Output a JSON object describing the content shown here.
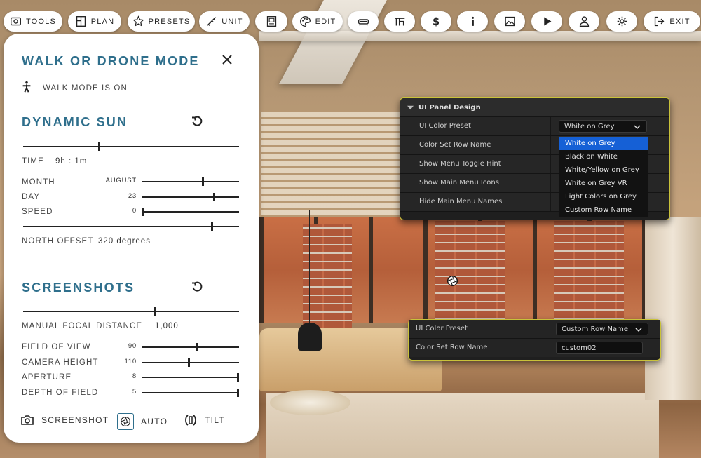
{
  "toolbar": {
    "tools": "TOOLS",
    "plan": "PLAN",
    "presets": "PRESETS",
    "unit": "UNIT",
    "edit": "EDIT",
    "exit": "EXIT"
  },
  "panel": {
    "walk": {
      "title": "WALK OR DRONE MODE",
      "status": "WALK MODE IS ON"
    },
    "sun": {
      "title": "DYNAMIC SUN",
      "time_label": "TIME",
      "time_value": "9h : 1m",
      "time_level": 0.35,
      "month_label": "MONTH",
      "month_value": "AUGUST",
      "month_level": 0.63,
      "day_label": "DAY",
      "day_value": "23",
      "day_level": 0.75,
      "speed_label": "SPEED",
      "speed_value": "0",
      "speed_level": 0.0,
      "north_level": 0.88,
      "north_label": "NORTH OFFSET",
      "north_value": "320 degrees"
    },
    "shots": {
      "title": "SCREENSHOTS",
      "focal_level": 0.61,
      "focal_label": "MANUAL FOCAL DISTANCE",
      "focal_value": "1,000",
      "fov_label": "FIELD OF VIEW",
      "fov_value": "90",
      "fov_level": 0.57,
      "height_label": "CAMERA HEIGHT",
      "height_value": "110",
      "height_level": 0.48,
      "aperture_label": "APERTURE",
      "aperture_value": "8",
      "aperture_level": 1.0,
      "dof_label": "DEPTH OF FIELD",
      "dof_value": "5",
      "dof_level": 1.0
    },
    "bottom": {
      "screenshot": "SCREENSHOT",
      "auto": "AUTO",
      "tilt": "TILT"
    }
  },
  "ue_panel": {
    "header": "UI Panel Design",
    "rows": [
      "UI Color Preset",
      "Color Set Row Name",
      "Show Menu Toggle Hint",
      "Show Main Menu Icons",
      "Hide Main Menu Names"
    ],
    "combo_value": "White on Grey",
    "options": [
      "White on Grey",
      "Black on White",
      "White/Yellow on Grey",
      "White on Grey VR",
      "Light Colors on Grey",
      "Custom Row Name"
    ]
  },
  "ue_panel2": {
    "row1_label": "UI Color Preset",
    "row1_value": "Custom Row Name",
    "row2_label": "Color Set Row Name",
    "row2_value": "custom02"
  },
  "colors": {
    "accent": "#2f6f8c",
    "selection": "#1560d6",
    "panel_border": "#c9c23a"
  }
}
